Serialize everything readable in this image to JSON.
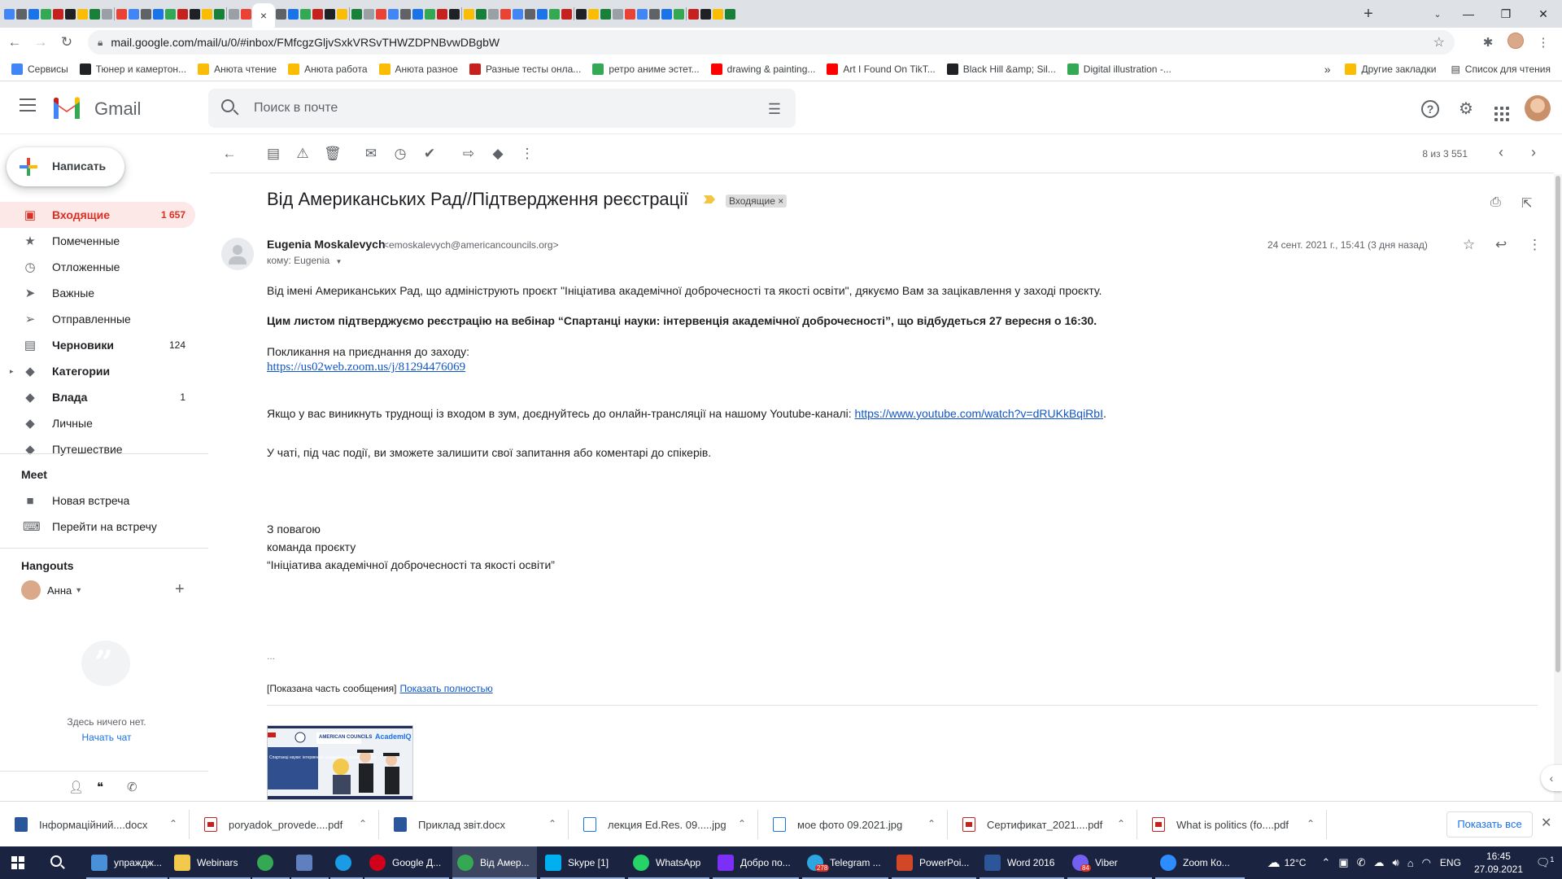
{
  "browser": {
    "url": "mail.google.com/mail/u/0/#inbox/FMfcgzGljvSxkVRSvTHWZDPNBvwDBgbW",
    "new_tab": "+",
    "close_tab": "×"
  },
  "bookmarks": {
    "items": [
      {
        "label": "Сервисы",
        "color": "#4285f4"
      },
      {
        "label": "Тюнер и камертон...",
        "color": "#202124"
      },
      {
        "label": "Анюта чтение",
        "color": "#fbbc04"
      },
      {
        "label": "Анюта работа",
        "color": "#fbbc04"
      },
      {
        "label": "Анюта разное",
        "color": "#fbbc04"
      },
      {
        "label": "Разные тесты онла...",
        "color": "#c5221f"
      },
      {
        "label": "ретро аниме эстет...",
        "color": "#34a853"
      },
      {
        "label": "drawing & painting...",
        "color": "#ff0000"
      },
      {
        "label": "Art I Found On TikT...",
        "color": "#ff0000"
      },
      {
        "label": "Black Hill &amp; Sil...",
        "color": "#202124"
      },
      {
        "label": "Digital illustration -...",
        "color": "#34a853"
      }
    ],
    "more": "»",
    "other": "Другие закладки",
    "reading_list": "Список для чтения"
  },
  "gmail": {
    "app_name": "Gmail",
    "search_placeholder": "Поиск в почте",
    "compose": "Написать",
    "nav": [
      {
        "label": "Входящие",
        "count": "1 657",
        "icon": "inbox-icon",
        "glyph": "▣",
        "active": true,
        "bold": true
      },
      {
        "label": "Помеченные",
        "count": "",
        "icon": "star-icon",
        "glyph": "★",
        "active": false,
        "bold": false
      },
      {
        "label": "Отложенные",
        "count": "",
        "icon": "clock-icon",
        "glyph": "◷",
        "active": false,
        "bold": false
      },
      {
        "label": "Важные",
        "count": "",
        "icon": "important-icon",
        "glyph": "➤",
        "active": false,
        "bold": false
      },
      {
        "label": "Отправленные",
        "count": "",
        "icon": "send-icon",
        "glyph": "➢",
        "active": false,
        "bold": false
      },
      {
        "label": "Черновики",
        "count": "124",
        "icon": "draft-icon",
        "glyph": "▤",
        "active": false,
        "bold": true
      },
      {
        "label": "Категории",
        "count": "",
        "icon": "label-icon",
        "glyph": "◆",
        "active": false,
        "bold": true,
        "caret": true
      },
      {
        "label": "Влада",
        "count": "1",
        "icon": "label-icon",
        "glyph": "◆",
        "active": false,
        "bold": true
      },
      {
        "label": "Личные",
        "count": "",
        "icon": "label-icon",
        "glyph": "◆",
        "active": false,
        "bold": false
      },
      {
        "label": "Путешествие",
        "count": "",
        "icon": "label-icon",
        "glyph": "◆",
        "active": false,
        "bold": false
      }
    ],
    "meet": {
      "title": "Meet",
      "new_meeting": "Новая встреча",
      "join_meeting": "Перейти на встречу"
    },
    "hangouts": {
      "title": "Hangouts",
      "user": "Анна",
      "empty": "Здесь ничего нет.",
      "start_chat": "Начать чат"
    },
    "pager": "8 из 3 551"
  },
  "email": {
    "subject": "Від Американських Рад//Підтвердження реєстрації",
    "label": "Входящие",
    "label_close": "×",
    "sender_name": "Eugenia Moskalevych",
    "sender_email": "<emoskalevych@americancouncils.org>",
    "to": "кому: Eugenia",
    "date": "24 сент. 2021 г., 15:41 (3 дня назад)",
    "body": {
      "p1": "Від імені Американських Рад, що адмініструють проєкт \"Ініціатива академічної доброчесності та якості освіти\", дякуємо Вам за зацікавлення у заході проєкту.",
      "p2": "Цим листом підтверджуємо реєстрацію на вебінар “Спартанці науки: інтервенція академічної доброчесності”, що відбудеться 27 вересня о 16:30.",
      "p3": "Покликання на приєднання до заходу:",
      "zoom_link": "https://us02web.zoom.us/j/81294476069",
      "p4": "Якщо у вас виникнуть труднощі із входом в зум, доєднуйтесь до онлайн-трансляції на нашому  Youtube-каналі: ",
      "youtube_link": "https://www.youtube.com/watch?v=dRUKkBqiRbI",
      "p4_end": ".",
      "p5": "У чаті, під час події, ви зможете залишити свої запитання або коментарі до спікерів.",
      "sign1": "З повагою",
      "sign2": "команда проєкту",
      "sign3": "“Ініціатива академічної доброчесності та якості освіти”",
      "ellipsis": "...",
      "shown_part": "[Показана часть сообщения]",
      "show_full": "Показать полностью"
    },
    "attachment_thumb": {
      "logo": "AMERICAN COUNCILS",
      "brand": "AcademIQ",
      "caption": "Спартанці науки: інтервенція академічної доброчесності"
    }
  },
  "downloads": {
    "items": [
      {
        "label": "Інформаційний....docx",
        "type": "word"
      },
      {
        "label": "poryadok_provede....pdf",
        "type": "pdf"
      },
      {
        "label": "Приклад звіт.docx",
        "type": "word"
      },
      {
        "label": "лекция Ed.Res. 09.....jpg",
        "type": "img"
      },
      {
        "label": "мое фото 09.2021.jpg",
        "type": "img"
      },
      {
        "label": "Сертификат_2021....pdf",
        "type": "pdf"
      },
      {
        "label": "What is politics (fo....pdf",
        "type": "pdf"
      }
    ],
    "show_all": "Показать все"
  },
  "taskbar": {
    "apps": [
      {
        "label": "упраждж...",
        "color": "#4a90d9"
      },
      {
        "label": "Webinars",
        "color": "#f2c94c"
      },
      {
        "label": "",
        "color": "#34a853"
      },
      {
        "label": "",
        "color": "#5f7fbf"
      },
      {
        "label": "",
        "color": "#1a9be6"
      },
      {
        "label": "Google Д...",
        "color": "#d0021b"
      },
      {
        "label": "Від Амер...",
        "color": "#34a853"
      },
      {
        "label": "Skype [1]",
        "color": "#00aff0"
      },
      {
        "label": "WhatsApp",
        "color": "#25d366"
      },
      {
        "label": "Добро по...",
        "color": "#7b2ff7"
      },
      {
        "label": "Telegram ...",
        "color": "#2ca5e0"
      },
      {
        "label": "PowerPoi...",
        "color": "#d24726"
      },
      {
        "label": "Word 2016",
        "color": "#2b579a"
      },
      {
        "label": "Viber",
        "color": "#7360f2"
      },
      {
        "label": "Zoom Ко...",
        "color": "#2d8cff"
      }
    ],
    "telegram_badge": "278",
    "viber_badge": "84",
    "weather": "12°C",
    "lang": "ENG",
    "time": "16:45",
    "date": "27.09.2021",
    "notifications": "1"
  }
}
